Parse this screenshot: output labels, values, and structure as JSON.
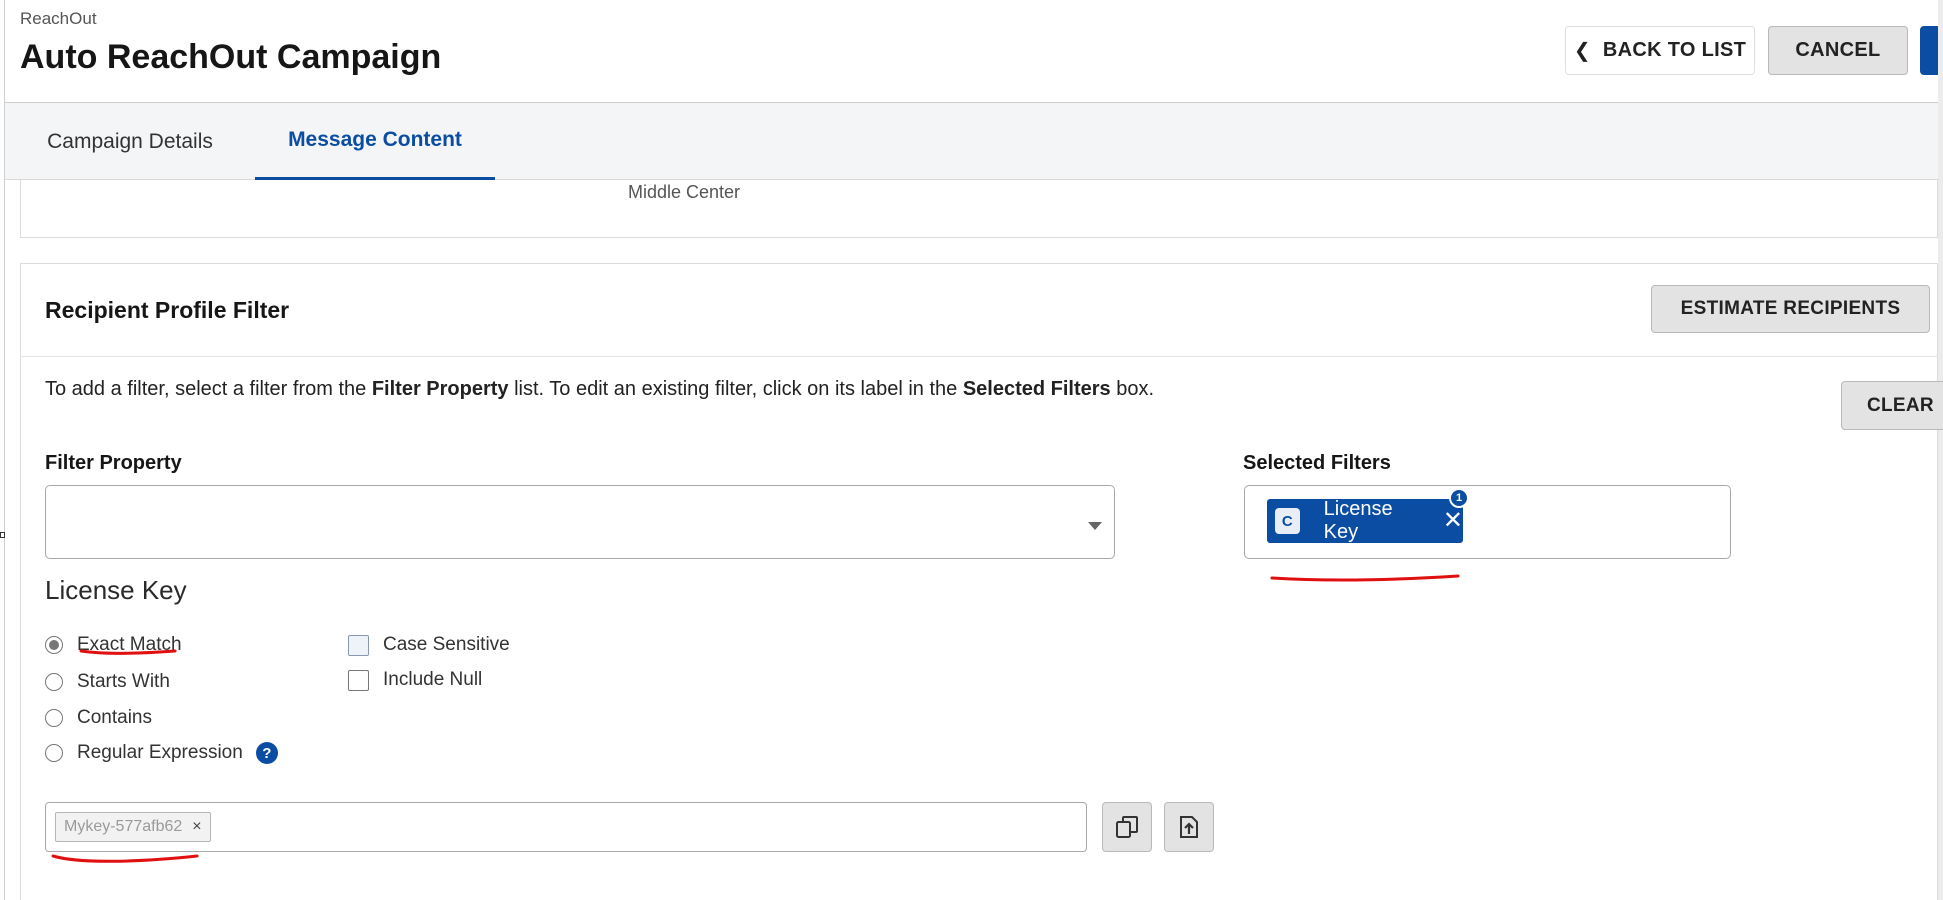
{
  "header": {
    "app_name": "ReachOut",
    "title": "Auto ReachOut Campaign",
    "back_label": "BACK TO LIST",
    "cancel_label": "CANCEL"
  },
  "tabs": [
    {
      "label": "Campaign Details",
      "active": false
    },
    {
      "label": "Message Content",
      "active": true
    }
  ],
  "position_panel": {
    "value": "Middle Center"
  },
  "recipient_filter": {
    "title": "Recipient Profile Filter",
    "estimate_label": "ESTIMATE RECIPIENTS",
    "clear_label": "CLEAR",
    "instructions": {
      "part1": "To add a filter, select a filter from the ",
      "bold1": "Filter Property",
      "part2": " list. To edit an existing filter, click on its label in the ",
      "bold2": "Selected Filters",
      "part3": " box."
    },
    "filter_property_label": "Filter Property",
    "filter_property_value": "",
    "selected_filters_label": "Selected Filters",
    "selected_filters": [
      {
        "type_badge": "C",
        "label": "License Key",
        "remove": "✕",
        "count": "1"
      }
    ]
  },
  "license_key": {
    "title": "License Key",
    "match_options": [
      {
        "label": "Exact Match",
        "selected": true
      },
      {
        "label": "Starts With",
        "selected": false
      },
      {
        "label": "Contains",
        "selected": false
      },
      {
        "label": "Regular Expression",
        "selected": false
      }
    ],
    "help_glyph": "?",
    "case_sensitive_label": "Case Sensitive",
    "case_sensitive_checked": false,
    "include_null_label": "Include Null",
    "include_null_checked": false,
    "values": [
      {
        "text": "Mykey-577afb62",
        "remove": "×"
      }
    ]
  },
  "icons": {
    "back": "chevron-left-icon",
    "dropdown": "caret-down-icon",
    "copy": "copy-icon",
    "upload": "upload-icon",
    "help": "question-icon",
    "remove": "close-icon"
  },
  "colors": {
    "accent": "#0b4da2",
    "annotation": "#e01010",
    "button_gray": "#e3e3e3"
  }
}
